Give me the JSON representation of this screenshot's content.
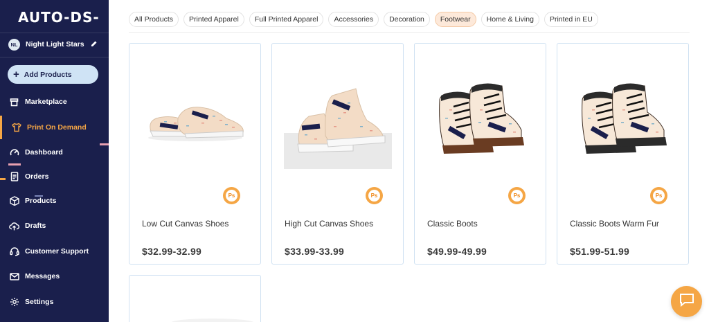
{
  "sidebar": {
    "logo": "AUTO-DS-",
    "store": {
      "initials": "NL",
      "name": "Night Light Stars"
    },
    "add_button": "Add Products",
    "items": [
      {
        "label": "Marketplace",
        "icon": "store-icon"
      },
      {
        "label": "Print On Demand",
        "icon": "print-shirt-icon",
        "active": true
      },
      {
        "label": "Dashboard",
        "icon": "gauge-icon"
      },
      {
        "label": "Orders",
        "icon": "document-icon"
      },
      {
        "label": "Products",
        "icon": "box-icon"
      },
      {
        "label": "Drafts",
        "icon": "cloud-upload-icon"
      },
      {
        "label": "Customer Support",
        "icon": "headset-icon"
      },
      {
        "label": "Messages",
        "icon": "envelope-icon"
      },
      {
        "label": "Settings",
        "icon": "gear-icon"
      }
    ]
  },
  "filters": {
    "items": [
      "All Products",
      "Printed Apparel",
      "Full Printed Apparel",
      "Accessories",
      "Decoration",
      "Footwear",
      "Home & Living",
      "Printed in EU"
    ],
    "selected": "Footwear"
  },
  "products": [
    {
      "name": "Low Cut Canvas Shoes",
      "price": "$32.99-32.99",
      "badge": "Ps"
    },
    {
      "name": "High Cut Canvas Shoes",
      "price": "$33.99-33.99",
      "badge": "Ps"
    },
    {
      "name": "Classic Boots",
      "price": "$49.99-49.99",
      "badge": "Ps"
    },
    {
      "name": "Classic Boots Warm Fur",
      "price": "$51.99-51.99",
      "badge": "Ps"
    }
  ],
  "colors": {
    "sidebar_bg": "#1a1f4c",
    "accent": "#f5a645",
    "card_border": "#cfe1f2",
    "chip_selected_bg": "#fde9da"
  },
  "chat": {
    "icon": "chat-bubble-icon"
  }
}
